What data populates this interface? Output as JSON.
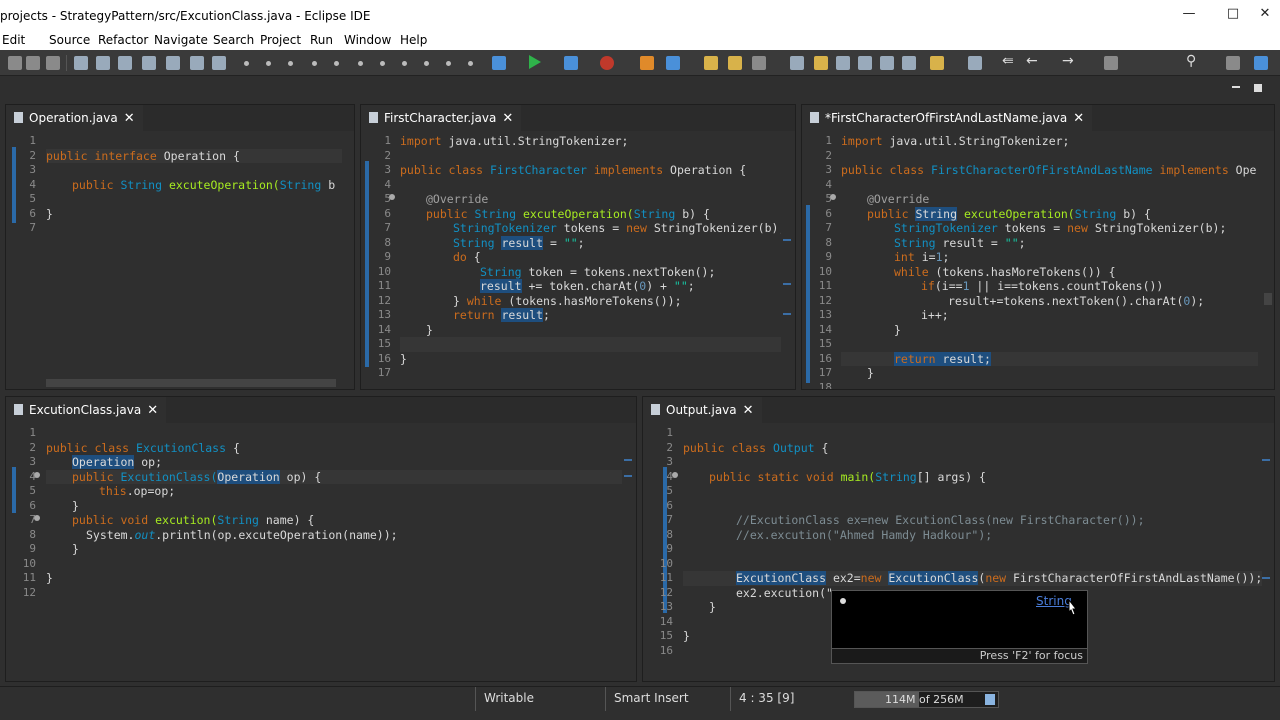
{
  "window": {
    "title": "projects - StrategyPattern/src/ExcutionClass.java - Eclipse IDE"
  },
  "menu": [
    "Edit",
    "Source",
    "Refactor",
    "Navigate",
    "Search",
    "Project",
    "Run",
    "Window",
    "Help"
  ],
  "panels": {
    "operation": {
      "tab": "Operation.java",
      "lines": [
        "1",
        "2",
        "3",
        "4",
        "5",
        "6",
        "7"
      ]
    },
    "firstCharacter": {
      "tab": "FirstCharacter.java",
      "lines": [
        "1",
        "2",
        "3",
        "4",
        "5",
        "6",
        "7",
        "8",
        "9",
        "10",
        "11",
        "12",
        "13",
        "14",
        "15",
        "16",
        "17"
      ]
    },
    "firstLast": {
      "tab": "*FirstCharacterOfFirstAndLastName.java",
      "lines": [
        "1",
        "2",
        "3",
        "4",
        "5",
        "6",
        "7",
        "8",
        "9",
        "10",
        "11",
        "12",
        "13",
        "14",
        "15",
        "16",
        "17",
        "18"
      ]
    },
    "excution": {
      "tab": "ExcutionClass.java",
      "lines": [
        "1",
        "2",
        "3",
        "4",
        "5",
        "6",
        "7",
        "8",
        "9",
        "10",
        "11",
        "12"
      ]
    },
    "output": {
      "tab": "Output.java",
      "lines": [
        "1",
        "2",
        "3",
        "4",
        "5",
        "6",
        "7",
        "8",
        "9",
        "10",
        "11",
        "12",
        "13",
        "14",
        "15",
        "16"
      ]
    }
  },
  "code": {
    "op2a": "public",
    "op2b": " interface ",
    "op2c": "Operation",
    "op2d": " {",
    "op4a": "public ",
    "op4b": "String",
    "op4c": " excuteOperation(",
    "op4d": "String",
    "op4e": " b );",
    "op6": "}",
    "fc1a": "import",
    "fc1b": " java.util.StringTokenizer;",
    "fc3a": "public class ",
    "fc3b": "FirstCharacter",
    "fc3c": " implements ",
    "fc3d": "Operation {",
    "fc5": "@Override",
    "fc6a": "public ",
    "fc6b": "String",
    "fc6c": " excuteOperation(",
    "fc6d": "String",
    "fc6e": " b) {",
    "fc7a": "StringTokenizer",
    "fc7b": " tokens = ",
    "fc7c": "new",
    "fc7d": " StringTokenizer(b);",
    "fc8a": "String",
    "fc8b": "result",
    "fc8c": " = ",
    "fc8d": "\"\"",
    "fc8e": ";",
    "fc9a": "do",
    "fc9b": " {",
    "fc10a": "String",
    "fc10b": " token = tokens.nextToken();",
    "fc11a": "result",
    "fc11b": " += token.charAt(",
    "fc11c": "0",
    "fc11d": ") + ",
    "fc11e": "\"\"",
    "fc11f": ";",
    "fc12a": "} ",
    "fc12b": "while",
    "fc12c": " (tokens.hasMoreTokens());",
    "fc13a": "return ",
    "fc13b": "result",
    "fc13c": ";",
    "fc14": "}",
    "fc16": "}",
    "fl1a": "import",
    "fl1b": " java.util.StringTokenizer;",
    "fl3a": "public class ",
    "fl3b": "FirstCharacterOfFirstAndLastName",
    "fl3c": " implements ",
    "fl3d": "Opera",
    "fl5": "@Override",
    "fl6a": "public ",
    "fl6b": "String",
    "fl6c": " excuteOperation(",
    "fl6d": "String",
    "fl6e": " b) {",
    "fl7a": "StringTokenizer",
    "fl7b": " tokens = ",
    "fl7c": "new",
    "fl7d": " StringTokenizer(b);",
    "fl8a": "String",
    "fl8b": " result = ",
    "fl8c": "\"\"",
    "fl8d": ";",
    "fl9a": "int",
    "fl9b": " i=",
    "fl9c": "1",
    "fl9d": ";",
    "fl10a": "while",
    "fl10b": " (tokens.hasMoreTokens()) {",
    "fl11a": "if",
    "fl11b": "(i==",
    "fl11c": "1",
    "fl11d": " || i==tokens.countTokens())",
    "fl12a": "result+=tokens.nextToken().charAt(",
    "fl12b": "0",
    "fl12c": ");",
    "fl13": "i++;",
    "fl14": "}",
    "fl16a": "return",
    "fl16b": " result;",
    "fl17": "}",
    "ex2a": "public class ",
    "ex2b": "ExcutionClass",
    "ex2c": " {",
    "ex3a": "Operation",
    "ex3b": " op;",
    "ex4a": "public ",
    "ex4b": "ExcutionClass(",
    "ex4c": "Operation",
    "ex4d": " op) {",
    "ex5a": "this",
    "ex5b": ".op=op;",
    "ex6": "}",
    "ex7a": "public void ",
    "ex7b": "excution(",
    "ex7c": "String",
    "ex7d": " name) {",
    "ex8a": "System.",
    "ex8b": "out",
    "ex8c": ".println(op.excuteOperation(name));",
    "ex9": "}",
    "ex11": "}",
    "ou2a": "public class ",
    "ou2b": "Output",
    "ou2c": " {",
    "ou4a": "public static void ",
    "ou4b": "main(",
    "ou4c": "String",
    "ou4d": "[] args) {",
    "ou7": "//ExcutionClass ex=new ExcutionClass(new FirstCharacter());",
    "ou8": "//ex.excution(\"Ahmed Hamdy Hadkour\");",
    "ou11a": "ExcutionClass",
    "ou11b": " ex2=",
    "ou11c": "new",
    "ou11d": "ExcutionClass",
    "ou11e": "(",
    "ou11f": "new",
    "ou11g": " FirstCharacterOfFirstAndLastName());",
    "ou12": "ex2.excution(\"",
    "ou13": "}",
    "ou15": "}"
  },
  "popup": {
    "link": "String",
    "footer": "Press 'F2' for focus"
  },
  "status": {
    "writable": "Writable",
    "insert": "Smart Insert",
    "position": "4 : 35 [9]",
    "heap": "114M of 256M",
    "heap_fraction": 0.445
  }
}
